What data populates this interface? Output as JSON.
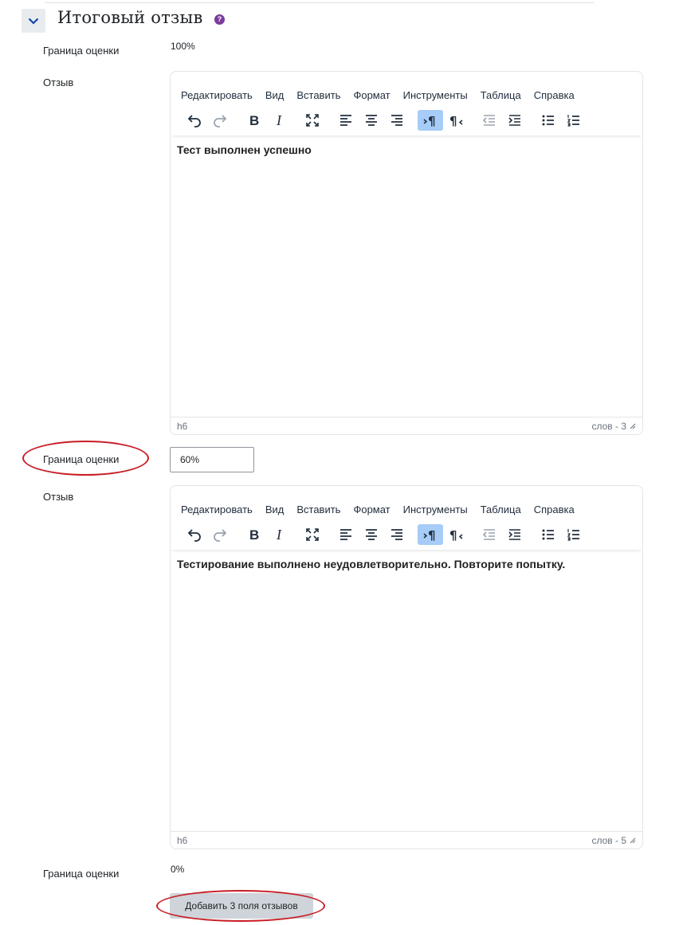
{
  "section": {
    "title": "Итоговый отзыв",
    "help_glyph": "?",
    "accent_color": "#7a3d9c"
  },
  "labels": {
    "grade_boundary": "Граница оценки",
    "feedback": "Отзыв"
  },
  "boundary1": {
    "value": "100%"
  },
  "boundary2": {
    "value": "60%"
  },
  "boundary3": {
    "value": "0%"
  },
  "editor_menu": [
    "Редактировать",
    "Вид",
    "Вставить",
    "Формат",
    "Инструменты",
    "Таблица",
    "Справка"
  ],
  "editor_toolbar_icons": [
    "undo-icon",
    "redo-icon",
    "bold-icon",
    "italic-icon",
    "fullscreen-icon",
    "align-left-icon",
    "align-center-icon",
    "align-right-icon",
    "ltr-icon",
    "rtl-icon",
    "outdent-icon",
    "indent-icon",
    "bullet-list-icon",
    "numbered-list-icon"
  ],
  "editor1": {
    "content": "Тест выполнен успешно",
    "path": "h6",
    "word_count": "слов - 3"
  },
  "editor2": {
    "content": "Тестирование выполнено неудовлетворительно. Повторите попытку.",
    "path": "h6",
    "word_count": "слов - 5"
  },
  "add_button": {
    "label": "Добавить 3 поля отзывов"
  },
  "annotation_color": "#c81d25"
}
